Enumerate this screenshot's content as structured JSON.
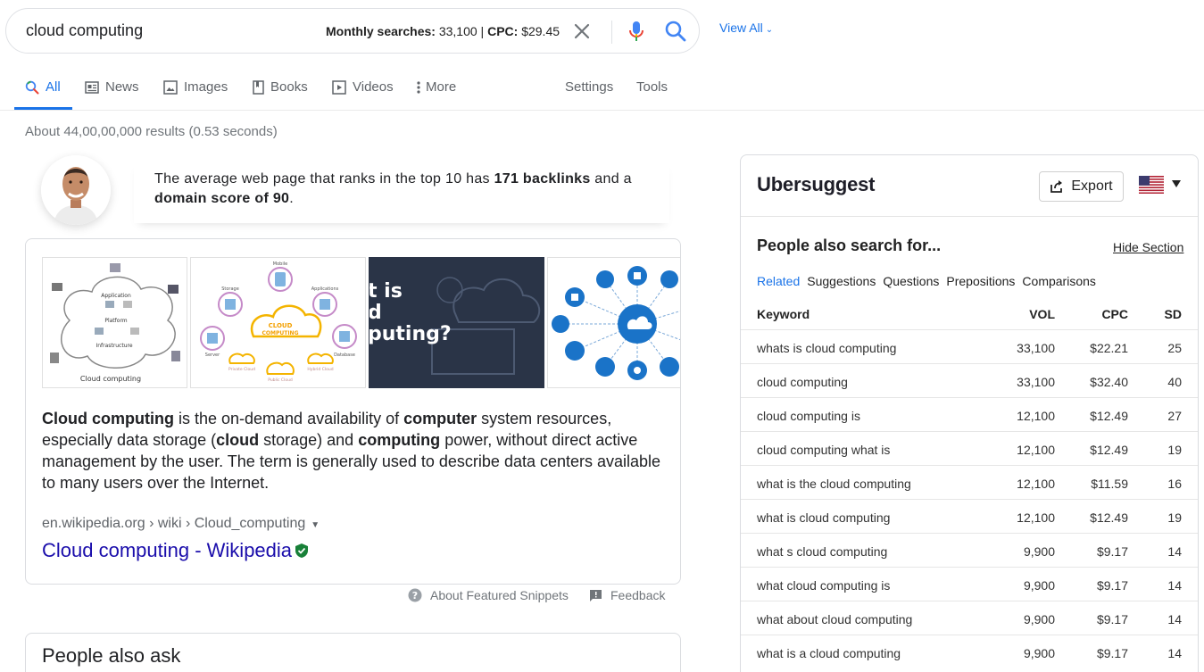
{
  "search": {
    "query": "cloud computing",
    "metrics_label_monthly": "Monthly searches:",
    "metrics_value_monthly": "33,100",
    "metrics_sep": "|",
    "metrics_label_cpc": "CPC:",
    "metrics_value_cpc": "$29.45",
    "view_all": "View All"
  },
  "tabs": [
    {
      "label": "All",
      "icon": "search-icon",
      "active": true
    },
    {
      "label": "News",
      "icon": "news-icon"
    },
    {
      "label": "Images",
      "icon": "image-icon"
    },
    {
      "label": "Books",
      "icon": "book-icon"
    },
    {
      "label": "Videos",
      "icon": "video-icon"
    },
    {
      "label": "More",
      "icon": "more-vert-icon"
    },
    {
      "label": "Settings"
    },
    {
      "label": "Tools"
    }
  ],
  "results_stats": "About 44,00,00,000 results (0.53 seconds)",
  "tip": {
    "t1": "The average web page that ranks in the top 10 has ",
    "b1": "171 backlinks",
    "t2": " and a ",
    "b2": "domain score of 90",
    "t3": "."
  },
  "snippet": {
    "thumb_texts": {
      "t1_application": "Application",
      "t1_platform": "Platform",
      "t1_infrastructure": "Infrastructure",
      "t1_caption": "Cloud computing",
      "t2_cloud": "CLOUD",
      "t2_computing": "COMPUTING",
      "t2_mobile": "Mobile",
      "t2_storage": "Storage",
      "t2_applications": "Applications",
      "t2_database": "Database",
      "t2_server": "Server",
      "t2_private": "Private Cloud",
      "t2_public": "Public Cloud",
      "t2_hybrid": "Hybrid Cloud",
      "t3_line1": "t is",
      "t3_line2": "d",
      "t3_line3": "puting?"
    },
    "desc": [
      {
        "b": "Cloud computing"
      },
      {
        "t": " is the on-demand availability of "
      },
      {
        "b": "computer"
      },
      {
        "t": " system resources, especially data storage ("
      },
      {
        "b": "cloud"
      },
      {
        "t": " storage) and "
      },
      {
        "b": "computing"
      },
      {
        "t": " power, without direct active management by the user. The term is generally used to describe data centers available to many users over the Internet."
      }
    ],
    "cite": "en.wikipedia.org › wiki › Cloud_computing",
    "link": "Cloud computing - Wikipedia"
  },
  "about_snippets": "About Featured Snippets",
  "feedback": "Feedback",
  "people_also_ask": "People also ask",
  "ubersuggest": {
    "brand": "Ubersuggest",
    "export": "Export",
    "title": "People also search for...",
    "hide": "Hide Section",
    "subtabs": [
      "Related",
      "Suggestions",
      "Questions",
      "Prepositions",
      "Comparisons"
    ],
    "headers": {
      "keyword": "Keyword",
      "vol": "VOL",
      "cpc": "CPC",
      "sd": "SD"
    },
    "rows": [
      {
        "keyword": "whats is cloud computing",
        "vol": "33,100",
        "cpc": "$22.21",
        "sd": "25"
      },
      {
        "keyword": "cloud computing",
        "vol": "33,100",
        "cpc": "$32.40",
        "sd": "40"
      },
      {
        "keyword": "cloud computing is",
        "vol": "12,100",
        "cpc": "$12.49",
        "sd": "27"
      },
      {
        "keyword": "cloud computing what is",
        "vol": "12,100",
        "cpc": "$12.49",
        "sd": "19"
      },
      {
        "keyword": "what is the cloud computing",
        "vol": "12,100",
        "cpc": "$11.59",
        "sd": "16"
      },
      {
        "keyword": "what is cloud computing",
        "vol": "12,100",
        "cpc": "$12.49",
        "sd": "19"
      },
      {
        "keyword": "what s cloud computing",
        "vol": "9,900",
        "cpc": "$9.17",
        "sd": "14"
      },
      {
        "keyword": "what cloud computing is",
        "vol": "9,900",
        "cpc": "$9.17",
        "sd": "14"
      },
      {
        "keyword": "what about cloud computing",
        "vol": "9,900",
        "cpc": "$9.17",
        "sd": "14"
      },
      {
        "keyword": "what is a cloud computing",
        "vol": "9,900",
        "cpc": "$9.17",
        "sd": "14"
      }
    ]
  },
  "colors": {
    "accent": "#1a73e8",
    "link": "#1a0dab",
    "muted": "#70757a"
  }
}
